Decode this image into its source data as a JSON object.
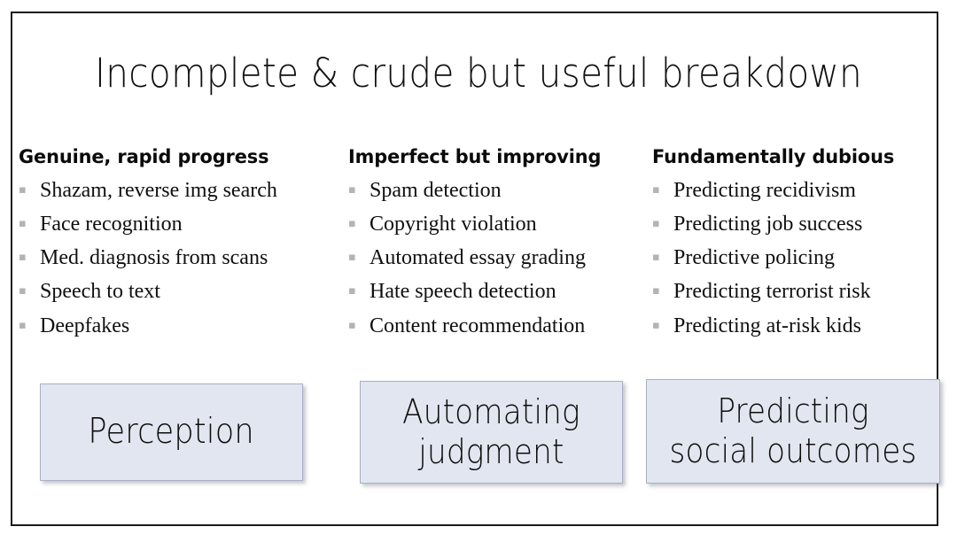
{
  "slide": {
    "title": "Incomplete & crude but useful breakdown",
    "frame_color": "#1a1a1a",
    "background": "#ffffff"
  },
  "columns": [
    {
      "header": "Genuine, rapid progress",
      "bullet_glyph": "▪",
      "items": [
        "Shazam, reverse img search",
        "Face recognition",
        "Med. diagnosis from scans",
        "Speech to text",
        "Deepfakes"
      ]
    },
    {
      "header": "Imperfect but improving",
      "bullet_glyph": "▪",
      "items": [
        "Spam detection",
        "Copyright violation",
        "Automated essay grading",
        "Hate speech detection",
        "Content recommendation"
      ]
    },
    {
      "header": "Fundamentally dubious",
      "bullet_glyph": "▪",
      "items": [
        "Predicting recidivism",
        "Predicting job success",
        "Predictive policing",
        "Predicting terrorist risk",
        "Predicting at-risk kids"
      ]
    }
  ],
  "category_boxes": [
    {
      "label": "Perception",
      "fill": "#e2e6f0",
      "border": "#a9b0c2"
    },
    {
      "label": "Automating\njudgment",
      "fill": "#e2e6f0",
      "border": "#a9b0c2"
    },
    {
      "label": "Predicting\nsocial outcomes",
      "fill": "#e2e6f0",
      "border": "#a9b0c2"
    }
  ]
}
